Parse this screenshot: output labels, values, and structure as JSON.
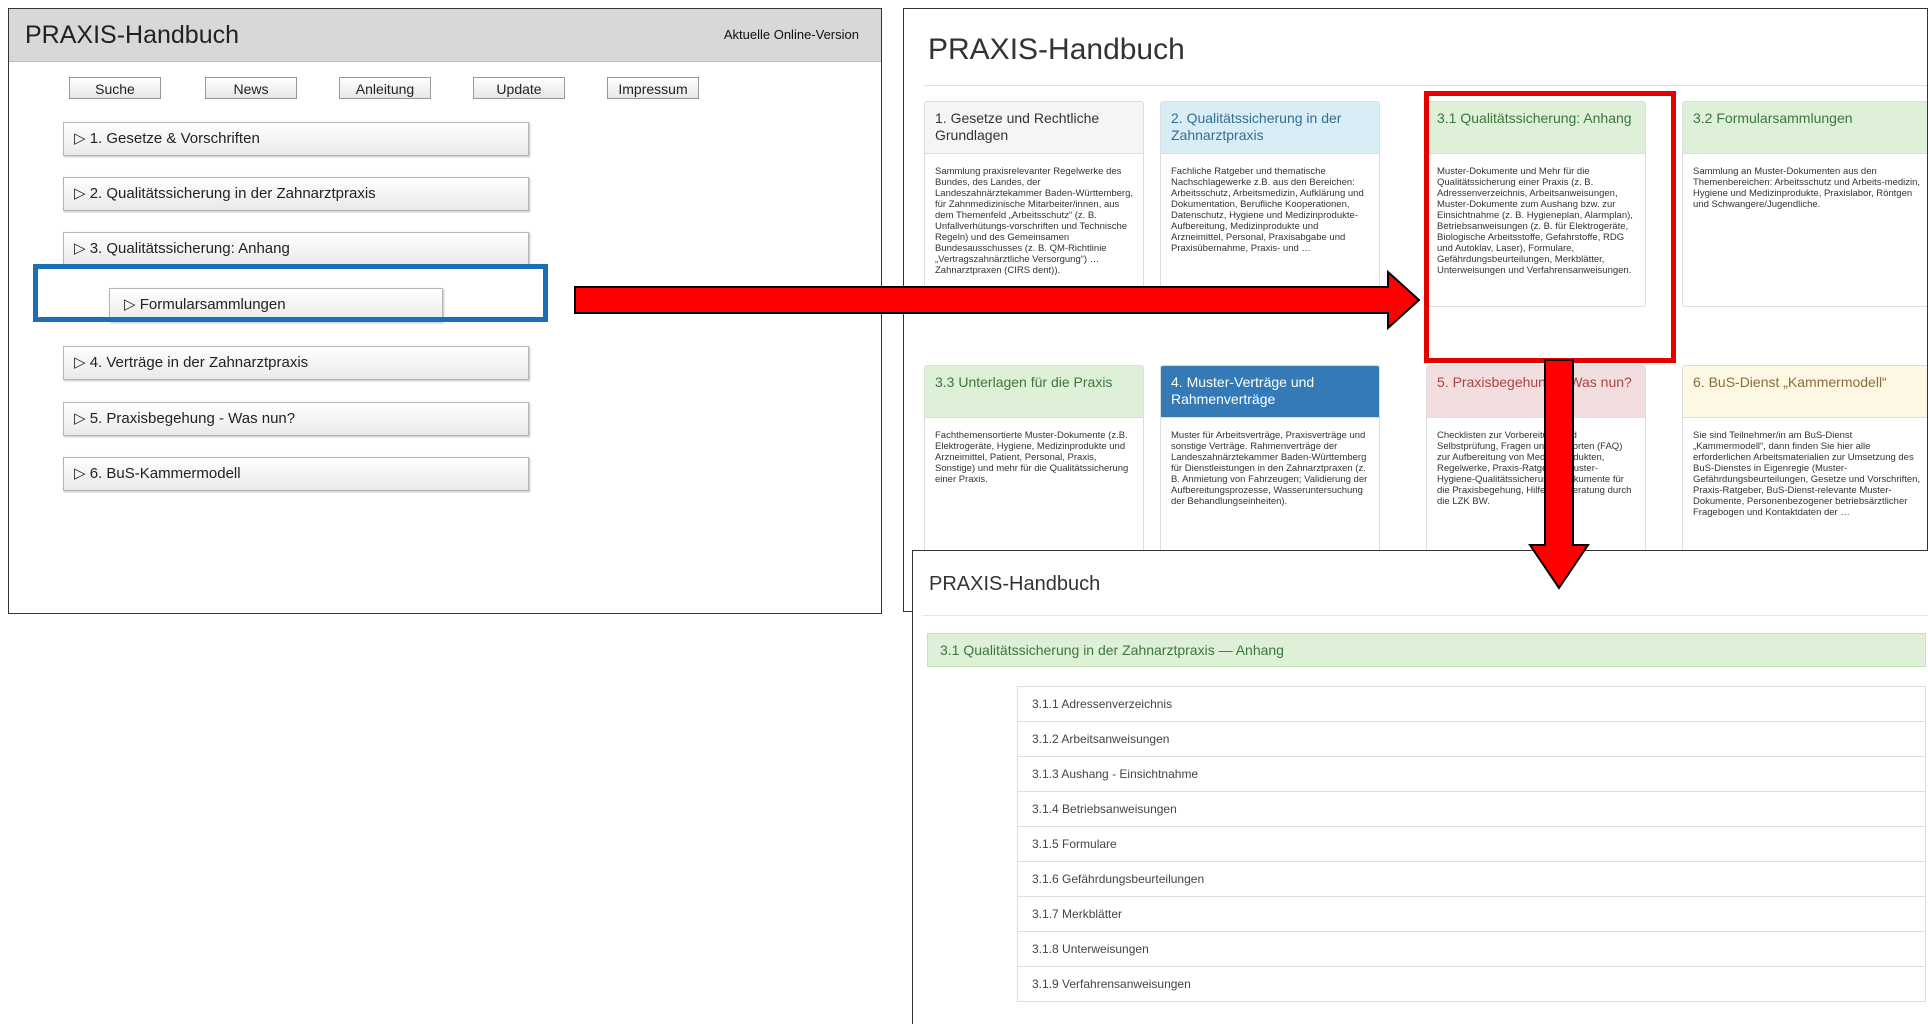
{
  "old": {
    "title": "PRAXIS-Handbuch",
    "online_link": "Aktuelle Online-Version",
    "nav": [
      "Suche",
      "News",
      "Anleitung",
      "Update",
      "Impressum"
    ],
    "items": [
      "▷ 1. Gesetze & Vorschriften",
      "▷ 2. Qualitätssicherung in der Zahnarztpraxis",
      "▷ 3. Qualitätssicherung: Anhang",
      "▷ Formularsammlungen",
      "▷ 4. Verträge in der Zahnarztpraxis",
      "▷ 5. Praxisbegehung - Was nun?",
      "▷ 6. BuS-Kammermodell"
    ]
  },
  "new": {
    "title": "PRAXIS-Handbuch",
    "cards": [
      {
        "head": "1. Gesetze und Rechtliche Grundlagen",
        "body": "Sammlung praxisrelevanter Regelwerke des Bundes, des Landes, der Landeszahnärztekammer Baden-Württemberg, für Zahnmedizinische Mitarbeiter/innen, aus dem Themenfeld „Arbeitsschutz“ (z. B. Unfallverhütungs-vorschriften und Technische Regeln) und des Gemeinsamen Bundesausschusses (z. B. QM-Richtlinie „Vertragszahnärztliche Versorgung“) … Zahnarztpraxen (CIRS dent))."
      },
      {
        "head": "2. Qualitätssicherung in der Zahnarztpraxis",
        "body": "Fachliche Ratgeber und thematische Nachschlagewerke z.B. aus den Bereichen: Arbeitsschutz, Arbeitsmedizin, Aufklärung und Dokumentation, Berufliche Kooperationen, Datenschutz, Hygiene und Medizinprodukte-Aufbereitung, Medizinprodukte und Arzneimittel, Personal, Praxisabgabe und Praxisübernahme, Praxis- und …"
      },
      {
        "head": "3.1 Qualitätssicherung: Anhang",
        "body": "Muster-Dokumente und Mehr für die Qualitätssicherung einer Praxis (z. B. Adressenverzeichnis, Arbeitsanweisungen, Muster-Dokumente zum Aushang bzw. zur Einsichtnahme (z. B. Hygieneplan, Alarmplan), Betriebsanweisungen (z. B. für Elektrogeräte, Biologische Arbeitsstoffe, Gefahrstoffe, RDG und Autoklav, Laser), Formulare, Gefährdungsbeurteilungen, Merkblätter, Unterweisungen und Verfahrensanweisungen."
      },
      {
        "head": "3.2 Formularsammlungen",
        "body": "Sammlung an Muster-Dokumenten aus den Themenbereichen: Arbeitsschutz und Arbeits-medizin, Hygiene und Medizinprodukte, Praxislabor, Röntgen und Schwangere/Jugendliche."
      },
      {
        "head": "3.3 Unterlagen für die Praxis",
        "body": "Fachthemensortierte Muster-Dokumente (z.B. Elektrogeräte, Hygiene, Medizinprodukte und Arzneimittel, Patient, Personal, Praxis, Sonstige) und mehr für die Qualitätssicherung einer Praxis."
      },
      {
        "head": "4. Muster-Verträge und Rahmenverträge",
        "body": "Muster für Arbeitsverträge, Praxisverträge und sonstige Verträge. Rahmenverträge der Landeszahnärztekammer Baden-Württemberg für Dienstleistungen in den Zahnarztpraxen (z. B. Anmietung von Fahrzeugen; Validierung der Aufbereitungsprozesse, Wasseruntersuchung der Behandlungseinheiten)."
      },
      {
        "head": "5. Praxisbegehung – Was nun?",
        "body": "Checklisten zur Vorbereitung und Selbstprüfung, Fragen und Antworten (FAQ) zur Aufbereitung von Medizinprodukten, Regelwerke, Praxis-Ratgeber, Muster-Hygiene-Qualitätssicherungs-Dokumente für die Praxisbegehung, Hilfe und Beratung durch die LZK BW."
      },
      {
        "head": "6. BuS-Dienst „Kammermodell“",
        "body": "Sie sind Teilnehmer/in am BuS-Dienst „Kammermodell“, dann finden Sie hier alle erforderlichen Arbeitsmaterialien zur Umsetzung des BuS-Dienstes in Eigenregie (Muster-Gefährdungsbeurteilungen, Gesetze und Vorschriften, Praxis-Ratgeber, BuS-Dienst-relevante Muster-Dokumente, Personenbezogener betriebsärztlicher Fragebogen und Kontaktdaten der …"
      }
    ]
  },
  "detail": {
    "title": "PRAXIS-Handbuch",
    "section": "3.1 Qualitätssicherung in der Zahnarztpraxis — Anhang",
    "items": [
      "3.1.1 Adressenverzeichnis",
      "3.1.2 Arbeitsanweisungen",
      "3.1.3 Aushang - Einsichtnahme",
      "3.1.4 Betriebsanweisungen",
      "3.1.5 Formulare",
      "3.1.6 Gefährdungsbeurteilungen",
      "3.1.7 Merkblätter",
      "3.1.8 Unterweisungen",
      "3.1.9 Verfahrensanweisungen"
    ]
  },
  "colors": {
    "highlight_blue": "#1a6fb5",
    "highlight_red": "#e60000",
    "arrow_red": "#ff0000"
  }
}
